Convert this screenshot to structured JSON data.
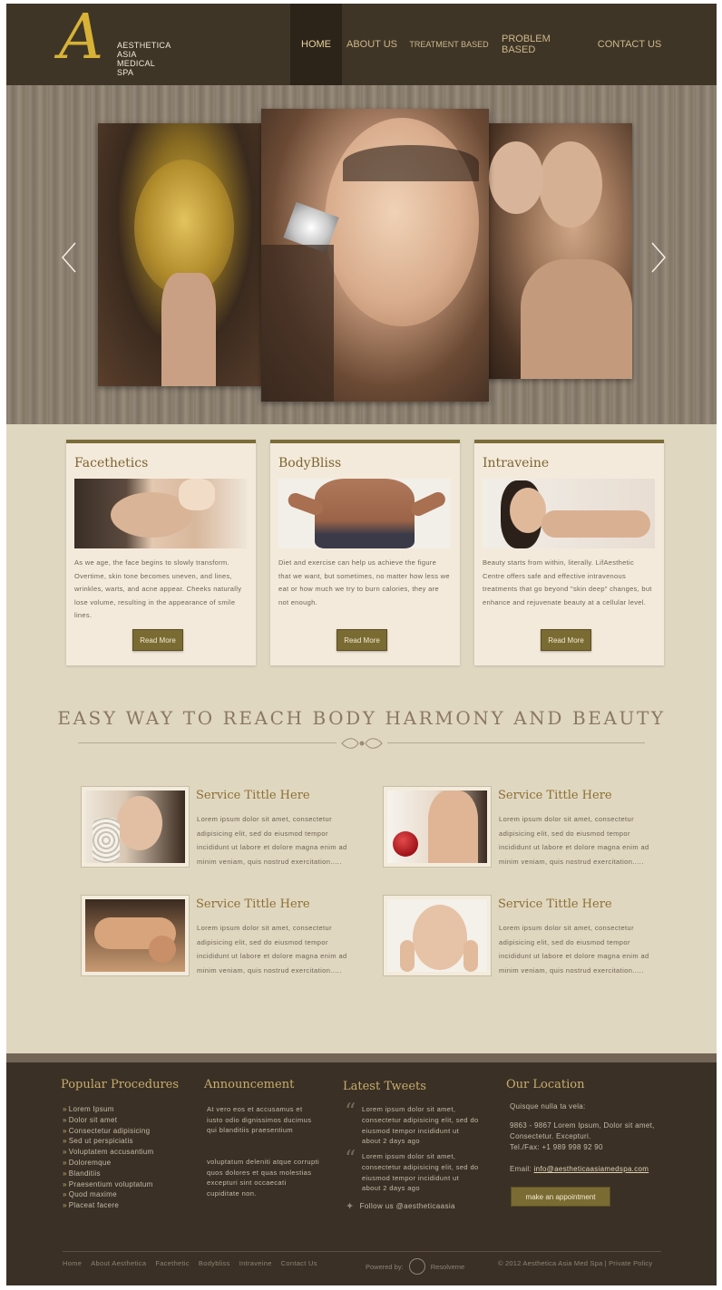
{
  "brand": {
    "monogram": "A",
    "line1": "AESTHETICA",
    "line2": "ASIA",
    "line3": "MEDICAL",
    "line4": "SPA"
  },
  "nav": [
    {
      "label": "HOME",
      "active": true
    },
    {
      "label": "ABOUT US",
      "active": false
    },
    {
      "label": "TREATMENT BASED",
      "active": false
    },
    {
      "label": "PROBLEM BASED",
      "active": false
    },
    {
      "label": "CONTACT US",
      "active": false
    }
  ],
  "slider": {
    "prev_icon": "chevron-left-icon",
    "next_icon": "chevron-right-icon"
  },
  "features": [
    {
      "title": "Facethetics",
      "text": "As we age, the face begins to slowly transform. Overtime, skin tone becomes uneven, and lines, wrinkles, warts, and acne appear. Cheeks naturally lose volume, resulting in the appearance of smile lines.",
      "button": "Read More"
    },
    {
      "title": "BodyBliss",
      "text": "Diet and exercise can help us achieve the figure that we want, but sometimes, no matter how less we eat or how much we try to burn calories, they are not enough.",
      "button": "Read More"
    },
    {
      "title": "Intraveine",
      "text": "Beauty starts from within, literally. LifAesthetic Centre offers safe and effective intravenous treatments that go beyond \"skin deep\" changes, but enhance and rejuvenate beauty at a cellular level.",
      "button": "Read More"
    }
  ],
  "headline": "EASY WAY TO REACH BODY HARMONY AND BEAUTY",
  "services": [
    {
      "title": "Service Tittle Here",
      "text": "Lorem ipsum dolor sit amet, consectetur adipisicing elit, sed do eiusmod tempor incididunt ut labore et dolore magna enim ad minim veniam, quis nostrud exercitation....."
    },
    {
      "title": "Service Tittle Here",
      "text": "Lorem ipsum dolor sit amet, consectetur adipisicing elit, sed do eiusmod tempor incididunt ut labore et dolore magna enim ad minim veniam, quis nostrud exercitation....."
    },
    {
      "title": "Service Tittle Here",
      "text": "Lorem ipsum dolor sit amet, consectetur adipisicing elit, sed do eiusmod tempor incididunt ut labore et dolore magna enim ad minim veniam, quis nostrud exercitation....."
    },
    {
      "title": "Service Tittle Here",
      "text": "Lorem ipsum dolor sit amet, consectetur adipisicing elit, sed do eiusmod tempor incididunt ut labore et dolore magna enim ad minim veniam, quis nostrud exercitation....."
    }
  ],
  "footer": {
    "procedures_title": "Popular Procedures",
    "procedures": [
      "Lorem Ipsum",
      "Dolor sit amet",
      "Consectetur adipisicing",
      "Sed ut perspiciatis",
      "Voluptatem accusantium",
      "Doloremque",
      "Blanditiis",
      "Praesentium voluptatum",
      "Quod maxime",
      "Placeat facere"
    ],
    "announcement_title": "Announcement",
    "announcement_1": "At vero eos et accusamus et iusto odio dignissimos ducimus qui blanditiis praesentium",
    "announcement_2": "voluptatum deleniti atque corrupti quos dolores et quas molestias excepturi sint occaecati cupiditate non.",
    "tweets_title": "Latest Tweets",
    "tweets": [
      {
        "text": "Lorem ipsum dolor sit amet, consectetur adipisicing elit, sed do eiusmod tempor incididunt ut",
        "time": "about 2 days ago"
      },
      {
        "text": "Lorem ipsum dolor sit amet, consectetur adipisicing elit, sed do eiusmod tempor incididunt ut",
        "time": "about 2 days ago"
      }
    ],
    "follow": "Follow us @aestheticaasia",
    "location_title": "Our Location",
    "location_sub": "Quisque nulla ta vela:",
    "address_1": "9863 - 9867 Lorem Ipsum, Dolor sit amet,",
    "address_2": "Consectetur. Excepturi.",
    "phone": "Tel./Fax: +1 989 998 92 90",
    "email_label": "Email:",
    "email": "info@aestheticaasiamedspa.com",
    "appointment_button": "make an appointment",
    "links": [
      "Home",
      "About Aesthetica",
      "Facethetic",
      "Bodybliss",
      "Intraveine",
      "Contact Us"
    ],
    "powered_label": "Powered by:",
    "powered_name": "Resolveme",
    "copyright": "© 2012 Aesthetica Asia Med Spa | Private Policy"
  },
  "colors": {
    "header_bg": "#3f3527",
    "page_bg": "#e0d7c1",
    "accent_gold": "#7a6b33",
    "heading_gold": "#7b6530"
  }
}
